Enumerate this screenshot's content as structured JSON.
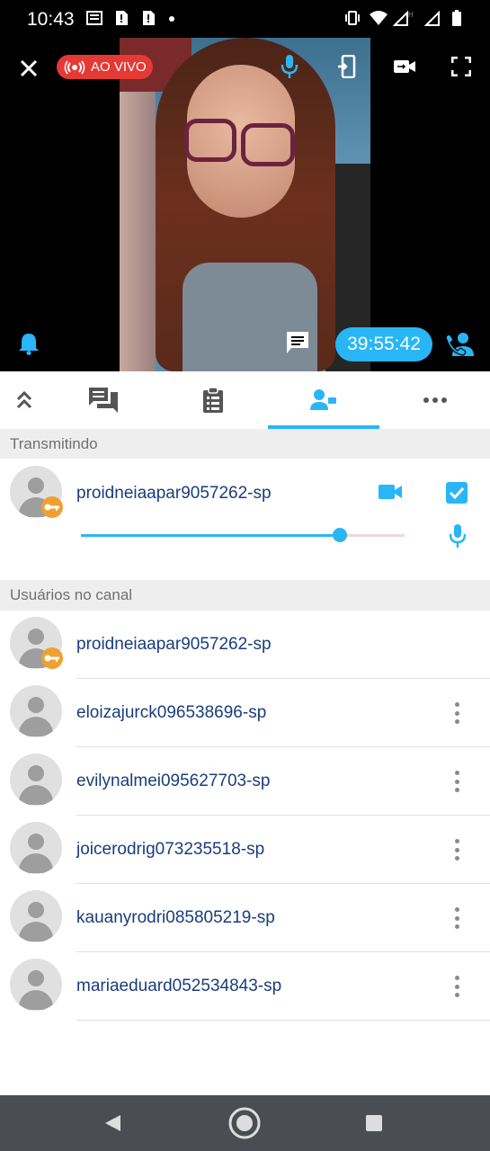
{
  "status_bar": {
    "time": "10:43"
  },
  "live": {
    "label": "AO VIVO"
  },
  "timer": "39:55:42",
  "tabs": [
    {
      "name": "collapse",
      "icon": "double-chevron-up-icon"
    },
    {
      "name": "chat",
      "icon": "chat-bubbles-icon"
    },
    {
      "name": "clipboard",
      "icon": "clipboard-list-icon"
    },
    {
      "name": "users",
      "icon": "person-speaker-icon",
      "active": true
    },
    {
      "name": "more",
      "icon": "more-horizontal-icon"
    }
  ],
  "sections": {
    "broadcasting": "Transmitindo",
    "channel_users": "Usuários no canal"
  },
  "broadcaster": {
    "username": "proidneiaapar9057262-sp",
    "volume": 0.8,
    "video_checked": true
  },
  "users": [
    {
      "username": "proidneiaapar9057262-sp",
      "owner": true
    },
    {
      "username": "eloizajurck096538696-sp",
      "owner": false
    },
    {
      "username": "evilynalmei095627703-sp",
      "owner": false
    },
    {
      "username": "joicerodrig073235518-sp",
      "owner": false
    },
    {
      "username": "kauanyrodri085805219-sp",
      "owner": false
    },
    {
      "username": "mariaeduard052534843-sp",
      "owner": false
    }
  ],
  "colors": {
    "accent": "#29b6f6",
    "live": "#e53935",
    "username": "#1a3d7c",
    "key_badge": "#f0a030"
  }
}
